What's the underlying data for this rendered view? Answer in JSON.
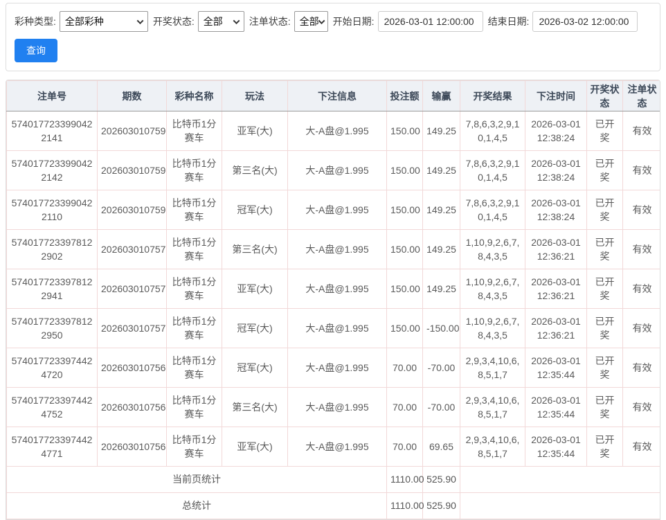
{
  "colors": {
    "accent_blue": "#2080f0",
    "header_bg": "#eef1f5",
    "header_text": "#3c4858",
    "grid_border": "#f2d8d8"
  },
  "filters": {
    "lottery_type": {
      "label": "彩种类型:",
      "value": "全部彩种"
    },
    "draw_status": {
      "label": "开奖状态:",
      "value": "全部"
    },
    "order_status": {
      "label": "注单状态:",
      "value": "全部"
    },
    "start_date": {
      "label": "开始日期:",
      "value": "2026-03-01 12:00:00"
    },
    "end_date": {
      "label": "结束日期:",
      "value": "2026-03-02 12:00:00"
    },
    "query_button_label": "查询"
  },
  "table": {
    "headers": [
      "注单号",
      "期数",
      "彩种名称",
      "玩法",
      "下注信息",
      "投注额",
      "输赢",
      "开奖结果",
      "下注时间",
      "开奖状态",
      "注单状态"
    ],
    "rows": [
      [
        "5740177233990422141",
        "202603010759",
        "比特币1分赛车",
        "亚军(大)",
        "大-A盘@1.995",
        "150.00",
        "149.25",
        "7,8,6,3,2,9,10,1,4,5",
        "2026-03-01 12:38:24",
        "已开奖",
        "有效"
      ],
      [
        "5740177233990422142",
        "202603010759",
        "比特币1分赛车",
        "第三名(大)",
        "大-A盘@1.995",
        "150.00",
        "149.25",
        "7,8,6,3,2,9,10,1,4,5",
        "2026-03-01 12:38:24",
        "已开奖",
        "有效"
      ],
      [
        "5740177233990422110",
        "202603010759",
        "比特币1分赛车",
        "冠军(大)",
        "大-A盘@1.995",
        "150.00",
        "149.25",
        "7,8,6,3,2,9,10,1,4,5",
        "2026-03-01 12:38:24",
        "已开奖",
        "有效"
      ],
      [
        "5740177233978122902",
        "202603010757",
        "比特币1分赛车",
        "第三名(大)",
        "大-A盘@1.995",
        "150.00",
        "149.25",
        "1,10,9,2,6,7,8,4,3,5",
        "2026-03-01 12:36:21",
        "已开奖",
        "有效"
      ],
      [
        "5740177233978122941",
        "202603010757",
        "比特币1分赛车",
        "亚军(大)",
        "大-A盘@1.995",
        "150.00",
        "149.25",
        "1,10,9,2,6,7,8,4,3,5",
        "2026-03-01 12:36:21",
        "已开奖",
        "有效"
      ],
      [
        "5740177233978122950",
        "202603010757",
        "比特币1分赛车",
        "冠军(大)",
        "大-A盘@1.995",
        "150.00",
        "-150.00",
        "1,10,9,2,6,7,8,4,3,5",
        "2026-03-01 12:36:21",
        "已开奖",
        "有效"
      ],
      [
        "5740177233974424720",
        "202603010756",
        "比特币1分赛车",
        "冠军(大)",
        "大-A盘@1.995",
        "70.00",
        "-70.00",
        "2,9,3,4,10,6,8,5,1,7",
        "2026-03-01 12:35:44",
        "已开奖",
        "有效"
      ],
      [
        "5740177233974424752",
        "202603010756",
        "比特币1分赛车",
        "第三名(大)",
        "大-A盘@1.995",
        "70.00",
        "-70.00",
        "2,9,3,4,10,6,8,5,1,7",
        "2026-03-01 12:35:44",
        "已开奖",
        "有效"
      ],
      [
        "5740177233974424771",
        "202603010756",
        "比特币1分赛车",
        "亚军(大)",
        "大-A盘@1.995",
        "70.00",
        "69.65",
        "2,9,3,4,10,6,8,5,1,7",
        "2026-03-01 12:35:44",
        "已开奖",
        "有效"
      ]
    ],
    "summary": [
      {
        "label": "当前页统计",
        "bet_total": "1110.00",
        "winloss_total": "525.90"
      },
      {
        "label": "总统计",
        "bet_total": "1110.00",
        "winloss_total": "525.90"
      }
    ]
  }
}
